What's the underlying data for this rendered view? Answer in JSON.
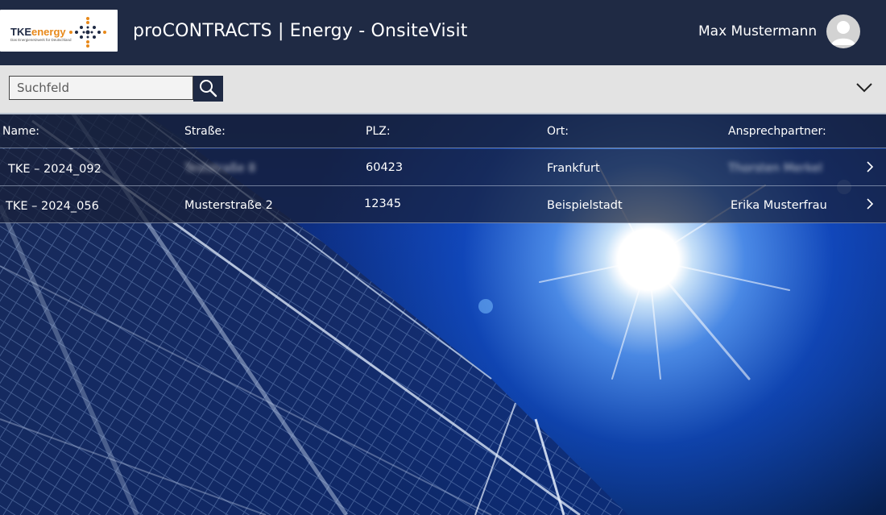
{
  "header": {
    "logo": {
      "brand_dark": "TKE",
      "brand_accent": "nergy",
      "brand_e": "e",
      "tagline": "Das Energienetzwerk für Deutschland",
      "alt": "TKEnergy logo"
    },
    "title": "proCONTRACTS | Energy - OnsiteVisit",
    "user_name": "Max Mustermann",
    "avatar_icon": "user-avatar-icon"
  },
  "search": {
    "placeholder": "Suchfeld",
    "value": "",
    "button_icon": "search-icon",
    "expand_icon": "chevron-down-icon"
  },
  "table": {
    "columns": [
      "Name:",
      "Straße:",
      "PLZ:",
      "Ort:",
      "Ansprechpartner:"
    ],
    "rows": [
      {
        "name": "TKE – 2024_092",
        "street": "Teststraße 8",
        "zip": "60423",
        "city": "Frankfurt",
        "contact": "Thorsten Merkel",
        "street_blurred": true,
        "contact_blurred": true
      },
      {
        "name": "TKE – 2024_056",
        "street": "Musterstraße 2",
        "zip": "12345",
        "city": "Beispielstadt",
        "contact": "Erika Musterfrau",
        "street_blurred": false,
        "contact_blurred": false
      }
    ],
    "row_action_icon": "chevron-right-icon"
  },
  "colors": {
    "header_bg": "#1f2a44",
    "search_strip_bg": "#e3e3e3",
    "logo_accent": "#e8891a",
    "logo_dark": "#1f2a44"
  }
}
